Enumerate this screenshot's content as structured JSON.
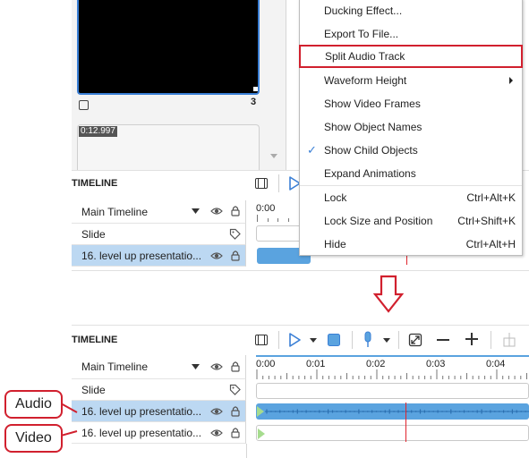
{
  "preview": {
    "slide_number": "3",
    "duration": "0:12.997"
  },
  "timeline": {
    "title": "TIMELINE",
    "rows": [
      {
        "label": "Main Timeline"
      },
      {
        "label": "Slide"
      },
      {
        "label": "16. level up presentatio..."
      },
      {
        "label": "16. level up presentatio..."
      }
    ],
    "ruler": [
      "0:00",
      "0:01",
      "0:02",
      "0:03",
      "0:04"
    ]
  },
  "menu": {
    "items": [
      {
        "label": "Ducking Effect...",
        "shortcut": ""
      },
      {
        "label": "Export To File...",
        "shortcut": ""
      },
      {
        "label": "Split Audio Track",
        "shortcut": ""
      },
      {
        "label": "Waveform Height",
        "shortcut": ""
      },
      {
        "label": "Show Video Frames",
        "shortcut": ""
      },
      {
        "label": "Show Object Names",
        "shortcut": ""
      },
      {
        "label": "Show Child Objects",
        "shortcut": ""
      },
      {
        "label": "Expand Animations",
        "shortcut": ""
      },
      {
        "label": "Lock",
        "shortcut": "Ctrl+Alt+K"
      },
      {
        "label": "Lock Size and Position",
        "shortcut": "Ctrl+Shift+K"
      },
      {
        "label": "Hide",
        "shortcut": "Ctrl+Alt+H"
      }
    ]
  },
  "callouts": {
    "audio": "Audio",
    "video": "Video"
  },
  "colors": {
    "accent": "#3a7fd5",
    "highlight": "#d1202e",
    "selected_row": "#bcd8f2",
    "audio_clip": "#5aa3df"
  },
  "icons": [
    "eye-icon",
    "lock-icon",
    "tag-icon",
    "play-icon",
    "stop-icon",
    "microphone-icon",
    "fit-icon",
    "zoom-out-icon",
    "zoom-in-icon",
    "down-arrow-icon"
  ]
}
